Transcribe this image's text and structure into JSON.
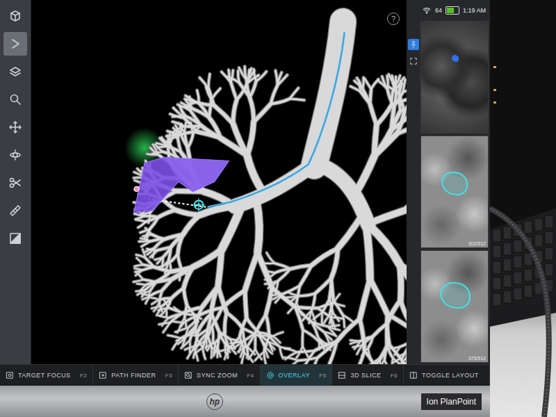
{
  "status": {
    "help": "?",
    "battery": "64",
    "battery_level": 0.64,
    "time": "1:19 AM"
  },
  "tools": [
    {
      "selected": false
    },
    {
      "selected": true
    },
    {
      "selected": false
    },
    {
      "selected": false
    },
    {
      "selected": false
    },
    {
      "selected": false
    },
    {
      "selected": false
    },
    {
      "selected": false
    },
    {
      "selected": false
    }
  ],
  "ct_views": [
    {
      "counter": ""
    },
    {
      "counter": "302/512"
    },
    {
      "counter": "375/512"
    }
  ],
  "bottom_bar": [
    {
      "label": "TARGET FOCUS",
      "key": "F2",
      "selected": false
    },
    {
      "label": "PATH FINDER",
      "key": "F3",
      "selected": false
    },
    {
      "label": "SYNC ZOOM",
      "key": "F4",
      "selected": false
    },
    {
      "label": "OVERLAY",
      "key": "F5",
      "selected": true
    },
    {
      "label": "3D SLICE",
      "key": "F6",
      "selected": false
    },
    {
      "label": "TOGGLE LAYOUT",
      "key": "",
      "selected": false
    }
  ],
  "bezel": {
    "logo": "hp",
    "label": "Ion PlanPoint"
  }
}
